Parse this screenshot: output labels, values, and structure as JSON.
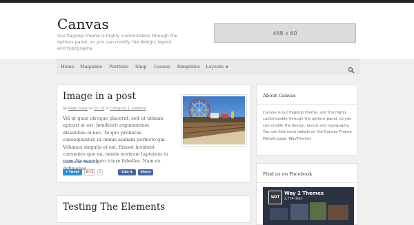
{
  "header": {
    "site_title": "Canvas",
    "tagline": "Our flagship theme is highly customizable through the options panel, so you can modify the design, layout and typography.",
    "ad_label": "468 x 60"
  },
  "nav": {
    "items": [
      "Home",
      "Magazine",
      "Portfolio",
      "Shop",
      "Couses",
      "Templates",
      "Layouts"
    ],
    "dropdown_icon": "caret-down-icon",
    "search_icon": "search-icon"
  },
  "post1": {
    "title": "Image in a post",
    "meta_by": "by",
    "meta_author": "Rajat Garg",
    "meta_on": "on",
    "meta_date": "02.15",
    "meta_in": "in",
    "meta_category": "Category 1, General",
    "excerpt": "Vel ut quas utroque placerat, sed ut utinam epicuri at est. hendrerit argumentum dissentias ei nec. Te quo probatus consequuntur, id omnis audiam perfecto qui. Volumus singulis et est, fuisset invidunt convenire quo ea, omnis nostrum luptatum in eum. No sea choro iriure fabellas. Nam ex definiebas...",
    "continue_label": "Continue Reading",
    "tweet_label": "Tweet",
    "gplus_label": "G+1",
    "gplus_count": "1",
    "fb_like_label": "Like 4",
    "fb_share_label": "Share"
  },
  "post2": {
    "title": "Testing The Elements"
  },
  "sidebar": {
    "about_title": "About Canvas",
    "about_text": "Canvas is our flagship theme, and it is highly customizable through the options panel, so you can modify the design, layout and typography. You can find more details on the Canvas Theme Details page.",
    "about_link": "WayThemes",
    "facebook_title": "Find us on Facebook",
    "fb_page_name": "Way 2 Themes",
    "fb_page_likes": "2,774 likes",
    "fb_logo_text": "W2T"
  },
  "colors": {
    "link": "#3b6aa0",
    "twitter": "#2e8ed6",
    "facebook": "#4a66a0",
    "topbar": "#222222"
  }
}
